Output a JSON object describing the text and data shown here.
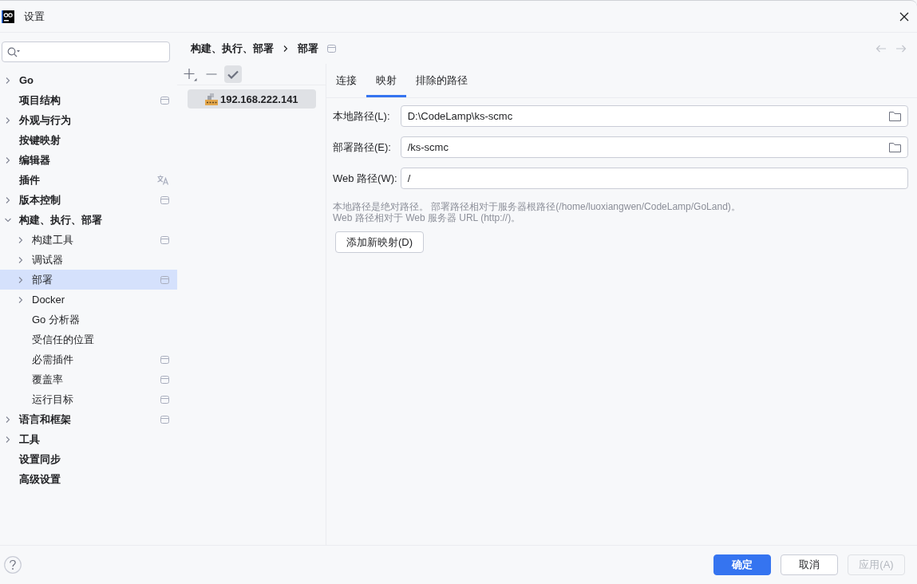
{
  "window": {
    "title": "设置"
  },
  "sidebar": {
    "items": [
      {
        "label": "Go",
        "kind": "plain",
        "expanded": false,
        "selected": false
      },
      {
        "label": "项目结构",
        "kind": "project",
        "selected": false
      },
      {
        "label": "外观与行为",
        "kind": "plain",
        "expanded": false,
        "selected": false
      },
      {
        "label": "按键映射",
        "kind": "plain",
        "selected": false
      },
      {
        "label": "编辑器",
        "kind": "plain",
        "expanded": false,
        "selected": false
      },
      {
        "label": "插件",
        "kind": "translatable",
        "selected": false
      },
      {
        "label": "版本控制",
        "kind": "project",
        "expanded": false,
        "selected": false
      },
      {
        "label": "构建、执行、部署",
        "kind": "plain",
        "expanded": true,
        "selected": false,
        "children": [
          {
            "label": "构建工具",
            "kind": "project",
            "expanded": false,
            "selected": false
          },
          {
            "label": "调试器",
            "kind": "plain",
            "expanded": false,
            "selected": false
          },
          {
            "label": "部署",
            "kind": "project",
            "expanded": false,
            "selected": true
          },
          {
            "label": "Docker",
            "kind": "plain",
            "expanded": false,
            "selected": false
          },
          {
            "label": "Go 分析器",
            "kind": "plain",
            "selected": false
          },
          {
            "label": "受信任的位置",
            "kind": "plain",
            "selected": false
          },
          {
            "label": "必需插件",
            "kind": "project",
            "selected": false
          },
          {
            "label": "覆盖率",
            "kind": "project",
            "selected": false
          },
          {
            "label": "运行目标",
            "kind": "project",
            "selected": false
          }
        ]
      },
      {
        "label": "语言和框架",
        "kind": "project",
        "expanded": false,
        "selected": false
      },
      {
        "label": "工具",
        "kind": "plain",
        "expanded": false,
        "selected": false
      },
      {
        "label": "设置同步",
        "kind": "plain",
        "selected": false
      },
      {
        "label": "高级设置",
        "kind": "plain",
        "selected": false
      }
    ]
  },
  "breadcrumb": [
    "构建、执行、部署",
    "部署"
  ],
  "toolbar": [
    {
      "kind": "add",
      "pressed": false
    },
    {
      "kind": "remove",
      "pressed": false
    },
    {
      "kind": "check",
      "pressed": true
    }
  ],
  "servers": [
    {
      "name": "192.168.222.141",
      "selected": true
    }
  ],
  "tabs": [
    {
      "label": "连接",
      "selected": false
    },
    {
      "label": "映射",
      "selected": true
    },
    {
      "label": "排除的路径",
      "selected": false
    }
  ],
  "mappings": [
    {
      "label": "本地路径(L):",
      "value": "D:\\CodeLamp\\ks-scmc",
      "browse": true
    },
    {
      "label": "部署路径(E):",
      "value": "/ks-scmc",
      "browse": true
    },
    {
      "label": "Web 路径(W):",
      "value": "/",
      "browse": false
    }
  ],
  "hints": [
    "本地路径是绝对路径。 部署路径相对于服务器根路径(/home/luoxiangwen/CodeLamp/GoLand)。",
    "Web 路径相对于 Web 服务器 URL (http://)。"
  ],
  "add_button": "添加新映射(D)",
  "footer": {
    "buttons": [
      {
        "label": "确定",
        "kind": "primary",
        "disabled": false
      },
      {
        "label": "取消",
        "kind": "normal",
        "disabled": false
      },
      {
        "label": "应用(A)",
        "kind": "normal",
        "disabled": true
      }
    ]
  }
}
